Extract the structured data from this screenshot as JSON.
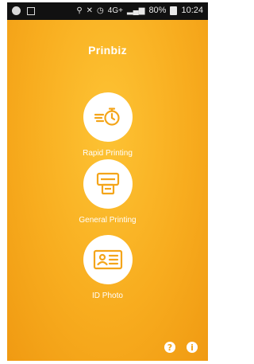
{
  "status_bar": {
    "battery_percent": "80%",
    "time": "10:24",
    "network_label": "4G+"
  },
  "app": {
    "logo": "Prinbiz"
  },
  "actions": [
    {
      "label": "Rapid Printing",
      "icon": "timer-print-icon"
    },
    {
      "label": "General Printing",
      "icon": "printer-icon"
    },
    {
      "label": "ID Photo",
      "icon": "id-card-icon"
    }
  ],
  "bottom": {
    "help_icon": "?",
    "info_icon": "i"
  },
  "colors": {
    "background": "#f8ad1f",
    "icon_orange": "#f4a51a",
    "circle": "#ffffff"
  }
}
